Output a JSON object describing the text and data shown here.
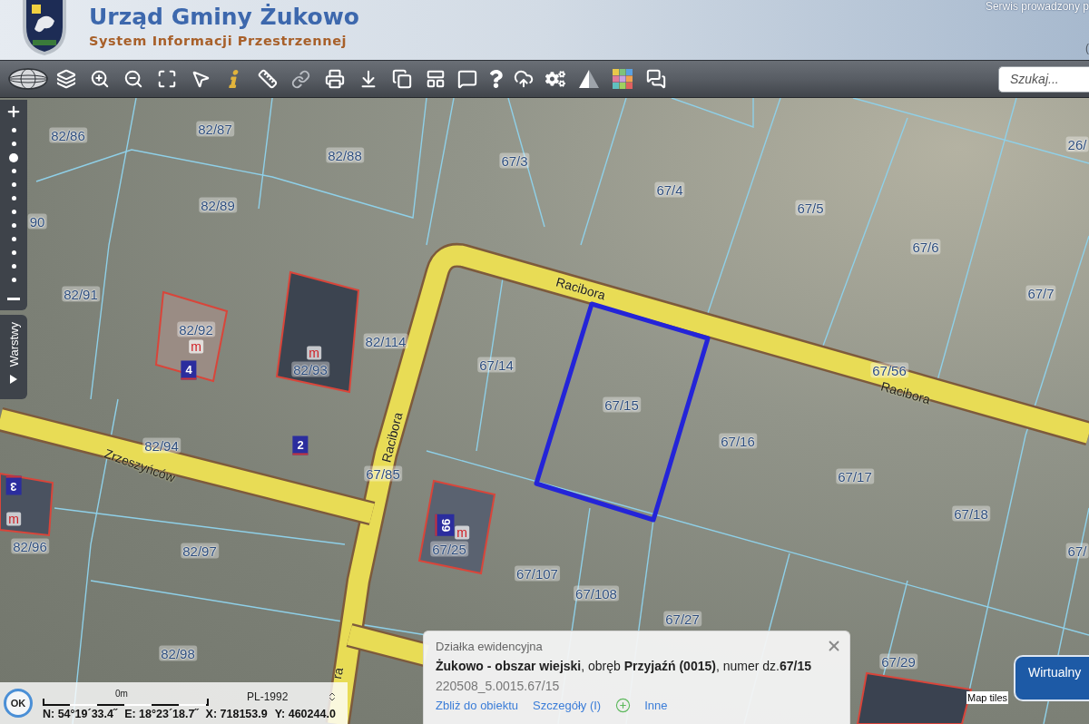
{
  "header": {
    "title": "Urząd Gminy Żukowo",
    "subtitle": "System Informacji Przestrzennej",
    "service_note": "Serwis prowadzony p",
    "corner_text": "("
  },
  "search": {
    "placeholder": "Szukaj..."
  },
  "zoom_slider": {
    "level": 0.82
  },
  "layers_tab": {
    "label": "Warstwy"
  },
  "map": {
    "labels": [
      {
        "text": "82/86",
        "kind": "parcel"
      },
      {
        "text": "82/87",
        "kind": "parcel"
      },
      {
        "text": "82/88",
        "kind": "parcel"
      },
      {
        "text": "67/3",
        "kind": "parcel"
      },
      {
        "text": "67/4",
        "kind": "parcel"
      },
      {
        "text": "26/",
        "kind": "parcel"
      },
      {
        "text": "67/5",
        "kind": "parcel"
      },
      {
        "text": "82/89",
        "kind": "parcel"
      },
      {
        "text": "90",
        "kind": "parcel"
      },
      {
        "text": "67/6",
        "kind": "parcel"
      },
      {
        "text": "82/91",
        "kind": "parcel"
      },
      {
        "text": "67/7",
        "kind": "parcel"
      },
      {
        "text": "Racibora",
        "kind": "street"
      },
      {
        "text": "82/92",
        "kind": "parcel"
      },
      {
        "text": "m",
        "kind": "land_use"
      },
      {
        "text": "m",
        "kind": "land_use"
      },
      {
        "text": "82/114",
        "kind": "parcel"
      },
      {
        "text": "4",
        "kind": "house_number"
      },
      {
        "text": "82/93",
        "kind": "parcel"
      },
      {
        "text": "67/14",
        "kind": "parcel"
      },
      {
        "text": "67/15",
        "kind": "parcel"
      },
      {
        "text": "67/56",
        "kind": "parcel"
      },
      {
        "text": "Racibora",
        "kind": "street"
      },
      {
        "text": "Racibora",
        "kind": "street"
      },
      {
        "text": "82/94",
        "kind": "parcel"
      },
      {
        "text": "2",
        "kind": "house_number"
      },
      {
        "text": "Zrzeszyńców",
        "kind": "street"
      },
      {
        "text": "67/16",
        "kind": "parcel"
      },
      {
        "text": "67/85",
        "kind": "parcel"
      },
      {
        "text": "67/17",
        "kind": "parcel"
      },
      {
        "text": "3",
        "kind": "house_number"
      },
      {
        "text": "67/18",
        "kind": "parcel"
      },
      {
        "text": "m",
        "kind": "land_use"
      },
      {
        "text": "99",
        "kind": "house_number"
      },
      {
        "text": "m",
        "kind": "land_use"
      },
      {
        "text": "82/96",
        "kind": "parcel"
      },
      {
        "text": "82/97",
        "kind": "parcel"
      },
      {
        "text": "67/25",
        "kind": "parcel"
      },
      {
        "text": "67/",
        "kind": "parcel"
      },
      {
        "text": "67/107",
        "kind": "parcel"
      },
      {
        "text": "67/108",
        "kind": "parcel"
      },
      {
        "text": "67/27",
        "kind": "parcel"
      },
      {
        "text": "82/98",
        "kind": "parcel"
      },
      {
        "text": "67/29",
        "kind": "parcel"
      },
      {
        "text": "ra",
        "kind": "street"
      }
    ]
  },
  "status_panel": {
    "indicator": "OK",
    "scale_label": "0m",
    "projection": {
      "value": "PL-1992"
    },
    "coordinates": [
      "N: 54°19´33.4˝",
      "E: 18°23´18.7˝",
      "X: 718153.9",
      "Y: 460244.0"
    ]
  },
  "popup": {
    "heading": "Działka ewidencyjna",
    "description": "**Żukowo - obszar wiejski**, obręb **Przyjaźń (0015)**, numer dz.**67/15**",
    "identifier": "220508_5.0015.67/15",
    "links": [
      {
        "label": "Zbliż do obiektu",
        "kind": "link"
      },
      {
        "label": "Szczegóły (I)",
        "kind": "link"
      },
      {
        "label": "Inne",
        "kind": "more"
      }
    ]
  },
  "attribution": "Map tiles",
  "virtual_button": {
    "label": "Wirtualny"
  }
}
